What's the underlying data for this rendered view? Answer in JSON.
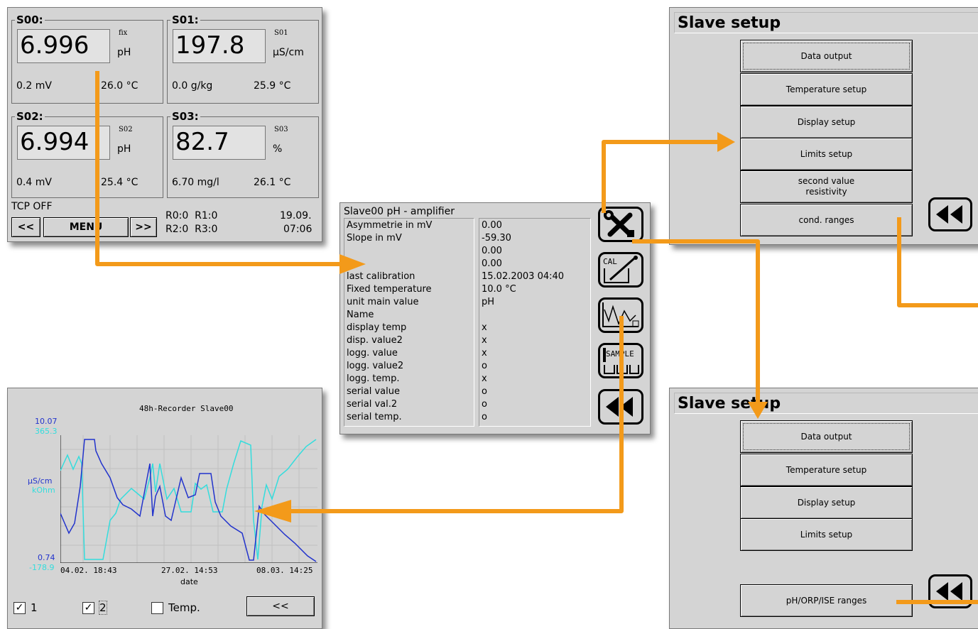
{
  "overview": {
    "sensors": [
      {
        "label": "S00:",
        "value": "6.996",
        "tag": "fix",
        "unit": "pH",
        "mv": "0.2 mV",
        "temp": "26.0 °C"
      },
      {
        "label": "S01:",
        "value": "197.8",
        "tag": "S01",
        "unit": "µS/cm",
        "mv": "0.0 g/kg",
        "temp": "25.9 °C"
      },
      {
        "label": "S02:",
        "value": "6.994",
        "tag": "S02",
        "unit": "pH",
        "mv": "0.4 mV",
        "temp": "25.4 °C"
      },
      {
        "label": "S03:",
        "value": "82.7",
        "tag": "S03",
        "unit": "%",
        "mv": "6.70 mg/l",
        "temp": "26.1 °C"
      }
    ],
    "tcp_status": "TCP OFF",
    "prev_label": "<<",
    "menu_label": "MENU",
    "next_label": ">>",
    "relays_line1": "R0:0  R1:0",
    "relays_line2": "R2:0  R3:0",
    "date": "19.09.",
    "time": "07:06"
  },
  "details": {
    "title": "Slave00 pH - amplifier",
    "rows": [
      {
        "label": "Asymmetrie in mV",
        "value": "0.00"
      },
      {
        "label": "Slope in mV",
        "value": "-59.30"
      },
      {
        "label": "",
        "value": "0.00"
      },
      {
        "label": "",
        "value": "0.00"
      },
      {
        "label": "last calibration",
        "value": "15.02.2003 04:40"
      },
      {
        "label": "Fixed temperature",
        "value": "10.0 °C"
      },
      {
        "label": "unit main value",
        "value": "pH"
      },
      {
        "label": "Name",
        "value": ""
      },
      {
        "label": "display temp",
        "value": "x"
      },
      {
        "label": "disp. value2",
        "value": "x"
      },
      {
        "label": "logg. value",
        "value": "x"
      },
      {
        "label": "logg. value2",
        "value": "o"
      },
      {
        "label": "logg. temp.",
        "value": "x"
      },
      {
        "label": "serial value",
        "value": "o"
      },
      {
        "label": "serial val.2",
        "value": "o"
      },
      {
        "label": "serial temp.",
        "value": "o"
      }
    ],
    "cal_label": "CAL",
    "sample_label": "SAMPLE"
  },
  "slave_setup_top": {
    "title": "Slave setup",
    "buttons": [
      "Data output",
      "Temperature setup",
      "Display setup",
      "Limits setup",
      "second value\nresistivity",
      "cond. ranges"
    ]
  },
  "slave_setup_bottom": {
    "title": "Slave setup",
    "buttons": [
      "Data output",
      "Temperature setup",
      "Display setup",
      "Limits setup",
      "pH/ORP/ISE ranges"
    ]
  },
  "recorder": {
    "title": "48h-Recorder Slave00",
    "y1_max": "10.07",
    "y2_max": "365.3",
    "y1_unit": "µS/cm",
    "y2_unit": "kOhm",
    "y1_min": "0.74",
    "y2_min": "-178.9",
    "x_ticks": [
      "04.02. 18:43",
      "27.02. 14:53",
      "08.03. 14:25"
    ],
    "x_label": "date",
    "check1_label": "1",
    "check2_label": "2",
    "check3_label": "Temp.",
    "check1": true,
    "check2": true,
    "check3": false,
    "back_label": "<<"
  },
  "colors": {
    "accent_orange": "#f39a1a",
    "series1": "#2233cc",
    "series2": "#33dddd",
    "panel_bg": "#d4d4d4"
  }
}
